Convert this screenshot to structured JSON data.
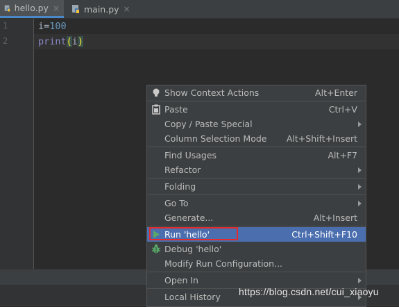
{
  "tabs": [
    {
      "label": "hello.py",
      "close": "×",
      "icon": "python-file-icon"
    },
    {
      "label": "main.py",
      "close": "×",
      "icon": "python-file-icon"
    }
  ],
  "gutter": {
    "lines": [
      "1",
      "2"
    ]
  },
  "code": {
    "line1": {
      "var": "i",
      "op": "=",
      "num": "100"
    },
    "line2": {
      "fn": "print",
      "open": "(",
      "arg": "i",
      "close": ")"
    }
  },
  "context_menu": {
    "show_context_actions": {
      "label": "Show Context Actions",
      "shortcut": "Alt+Enter",
      "icon": "lightbulb-icon"
    },
    "paste": {
      "label": "Paste",
      "shortcut": "Ctrl+V",
      "icon": "clipboard-icon"
    },
    "copy_paste_special": {
      "label": "Copy / Paste Special"
    },
    "column_selection_mode": {
      "label": "Column Selection Mode",
      "shortcut": "Alt+Shift+Insert"
    },
    "find_usages": {
      "label": "Find Usages",
      "shortcut": "Alt+F7"
    },
    "refactor": {
      "label": "Refactor"
    },
    "folding": {
      "label": "Folding"
    },
    "go_to": {
      "label": "Go To"
    },
    "generate": {
      "label": "Generate...",
      "shortcut": "Alt+Insert"
    },
    "run": {
      "label": "Run 'hello'",
      "shortcut": "Ctrl+Shift+F10",
      "icon": "run-icon",
      "selected": true
    },
    "debug": {
      "label": "Debug 'hello'",
      "icon": "bug-icon"
    },
    "modify_run_config": {
      "label": "Modify Run Configuration..."
    },
    "open_in": {
      "label": "Open In"
    },
    "local_history": {
      "label": "Local History"
    }
  },
  "watermark": "https://blog.csdn.net/cui_xiaoyu",
  "colors": {
    "accent": "#4b6eaf",
    "highlight_box": "#e32b2b",
    "background": "#2b2b2b"
  }
}
